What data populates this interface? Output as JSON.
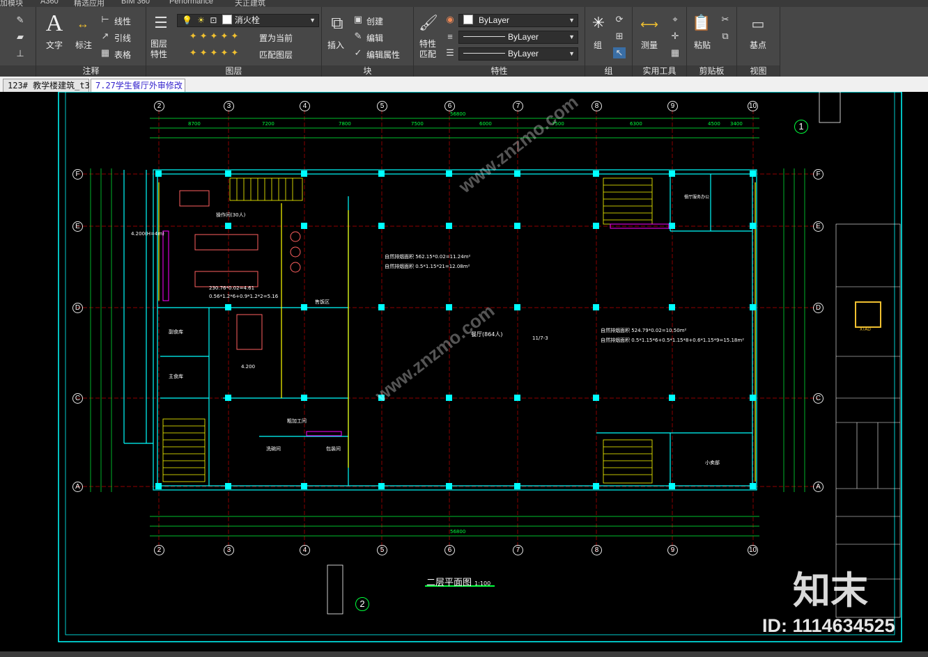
{
  "ribbon": {
    "tabs": [
      "加模块",
      "A360",
      "精选应用",
      "BIM 360",
      "Performance",
      "天正建筑"
    ],
    "panels": {
      "annotation": {
        "title": "注释",
        "text_btn": "文字",
        "dim_btn": "标注",
        "linear": "线性",
        "leader": "引线",
        "table": "表格"
      },
      "layers": {
        "title": "图层",
        "layer_props": "图层特性",
        "current_layer": "消火栓",
        "set_current": "置为当前",
        "match_layer": "匹配图层"
      },
      "block": {
        "title": "块",
        "insert": "插入",
        "create": "创建",
        "edit": "编辑",
        "edit_attr": "编辑属性"
      },
      "properties": {
        "title": "特性",
        "match_props": "特性匹配",
        "color": "ByLayer",
        "linetype": "ByLayer",
        "lineweight": "ByLayer"
      },
      "group": {
        "title": "组",
        "group_btn": "组"
      },
      "utilities": {
        "title": "实用工具",
        "measure": "测量"
      },
      "clipboard": {
        "title": "剪贴板",
        "paste": "粘贴"
      },
      "view": {
        "title": "视图",
        "base": "基点"
      }
    }
  },
  "doc_tabs": [
    "123# 教学楼建筑_t3",
    "7.27学生餐厅外审修改"
  ],
  "drawing": {
    "axes_top": [
      "2",
      "3",
      "4",
      "5",
      "6",
      "7",
      "8",
      "9",
      "10"
    ],
    "axes_left": [
      "F",
      "E",
      "D",
      "C",
      "A"
    ],
    "axes_right": [
      "F",
      "E",
      "D",
      "C",
      "A"
    ],
    "total_dim": "56800",
    "top_dims": [
      "8700",
      "7200",
      "7800",
      "7500",
      "6000",
      "7500",
      "6300",
      "4500",
      "3400"
    ],
    "room_labels": {
      "dining_hall": "餐厅(864人)",
      "kitchen": "操作间(30人)",
      "store1": "副食库",
      "store2": "主食库",
      "small_kitchen": "小卖部",
      "office": "餐厅服务办公",
      "aisle": "售饭区",
      "washroom": "洗碗间",
      "packing": "包装间",
      "prep": "粗加工间"
    },
    "notes": {
      "n1": "自然排烟面积 562.15*0.02=11.24m²",
      "n2": "自然排烟面积 0.5*1.15*21=12.08m²",
      "n3": "自然排烟面积 524.79*0.02=10.50m²",
      "n4": "自然排烟面积 0.5*1.15*6+0.5*1.15*8+0.6*1.15*9=15.18m²",
      "n5": "230.76*0.02=4.61",
      "n6": "0.56*1.2*6+0.9*1.2*2=5.16",
      "n7": "4.200",
      "n8": "4.200(H=4m)",
      "n9": "11/7-3"
    },
    "plan_title": "二层平面图",
    "plan_scale": "1:100",
    "detail_1": "1",
    "detail_2": "2",
    "title_block_logo": "XTAD"
  },
  "watermark": {
    "brand": "知末",
    "id": "ID: 1114634525",
    "site": "www.znzmo.com"
  }
}
